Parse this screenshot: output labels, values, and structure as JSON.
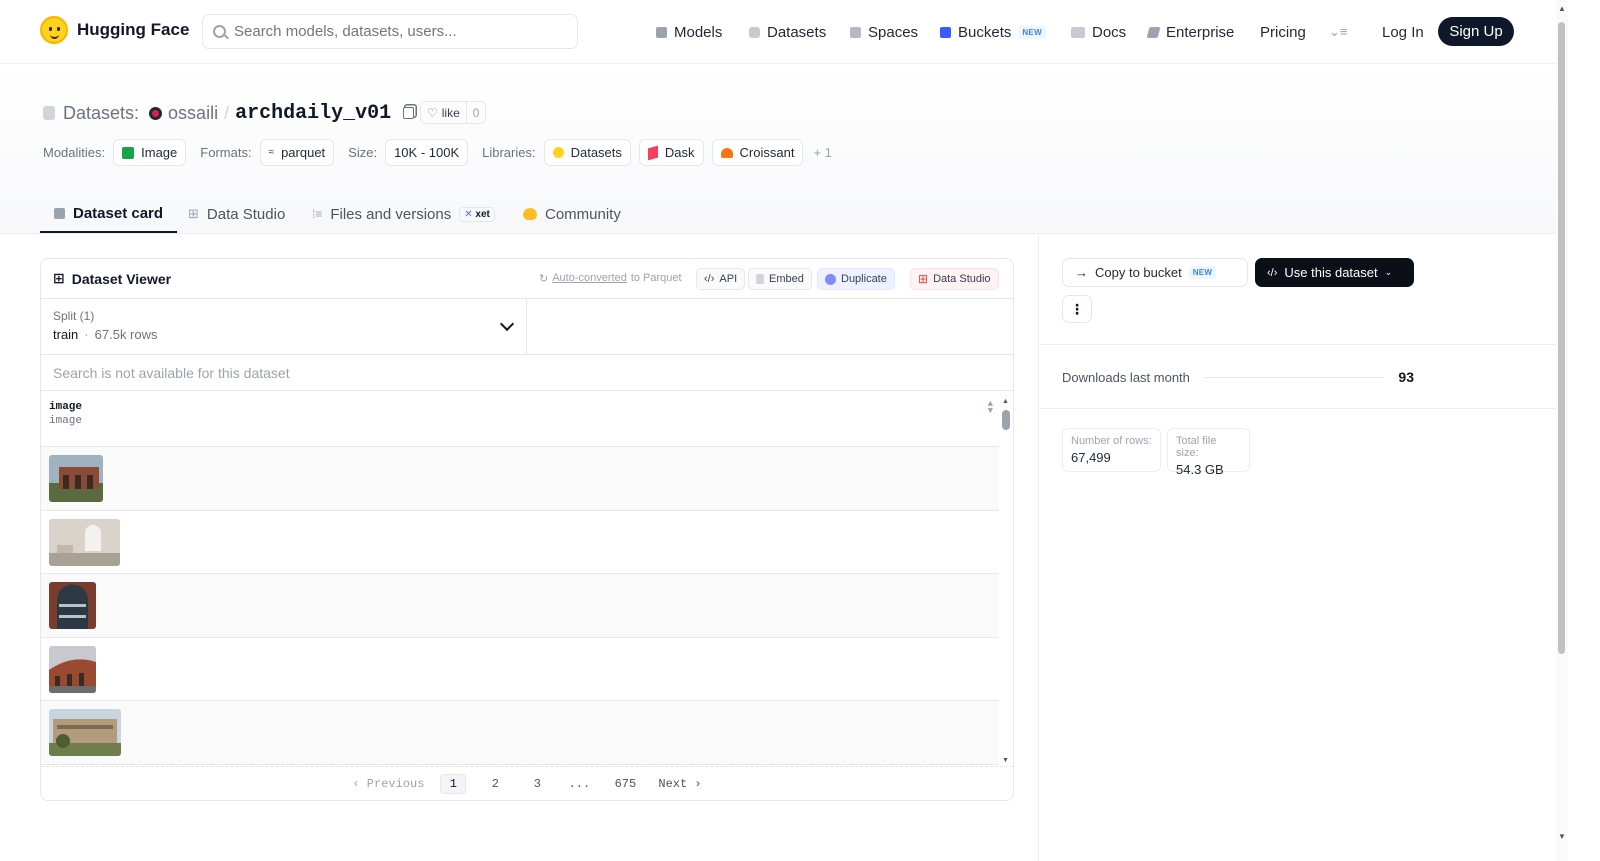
{
  "nav": {
    "brand": "Hugging Face",
    "search_placeholder": "Search models, datasets, users...",
    "items": [
      "Models",
      "Datasets",
      "Spaces",
      "Buckets",
      "Docs",
      "Enterprise",
      "Pricing"
    ],
    "new_badge": "NEW",
    "login": "Log In",
    "signup": "Sign Up"
  },
  "header": {
    "section": "Datasets:",
    "owner": "ossaili",
    "slash": "/",
    "repo": "archdaily_v01",
    "like_label": "like",
    "like_count": "0",
    "modalities_label": "Modalities:",
    "modality": "Image",
    "formats_label": "Formats:",
    "format": "parquet",
    "size_label": "Size:",
    "size": "10K - 100K",
    "libraries_label": "Libraries:",
    "libraries": [
      "Datasets",
      "Dask",
      "Croissant"
    ],
    "libraries_more": "+ 1"
  },
  "tabs": [
    "Dataset card",
    "Data Studio",
    "Files and versions",
    "Community"
  ],
  "tabs_xet": "xet",
  "viewer": {
    "title": "Dataset Viewer",
    "auto_converted": "Auto-converted",
    "to_parquet": "to Parquet",
    "api": "API",
    "embed": "Embed",
    "duplicate": "Duplicate",
    "data_studio": "Data Studio",
    "split_label": "Split (1)",
    "split_name": "train",
    "split_rows": "67.5k rows",
    "search_disabled": "Search is not available for this dataset",
    "column_name": "image",
    "column_type": "image",
    "rows_count": 5,
    "pager": {
      "previous": "Previous",
      "pages": [
        "1",
        "2",
        "3",
        "...",
        "675"
      ],
      "next": "Next"
    }
  },
  "side": {
    "copy_bucket": "Copy to bucket",
    "new_badge": "NEW",
    "use_dataset": "Use this dataset",
    "downloads_label": "Downloads last month",
    "downloads_value": "93",
    "rows_label": "Number of rows:",
    "rows_value": "67,499",
    "size_label": "Total file size:",
    "size_value": "54.3 GB"
  },
  "colors": {
    "accent": "#0f172a",
    "hf_yellow": "#ffd21e",
    "link_blue": "#3b82f6",
    "duplicate_purple": "#6366f1",
    "studio_red": "#ef4444"
  }
}
